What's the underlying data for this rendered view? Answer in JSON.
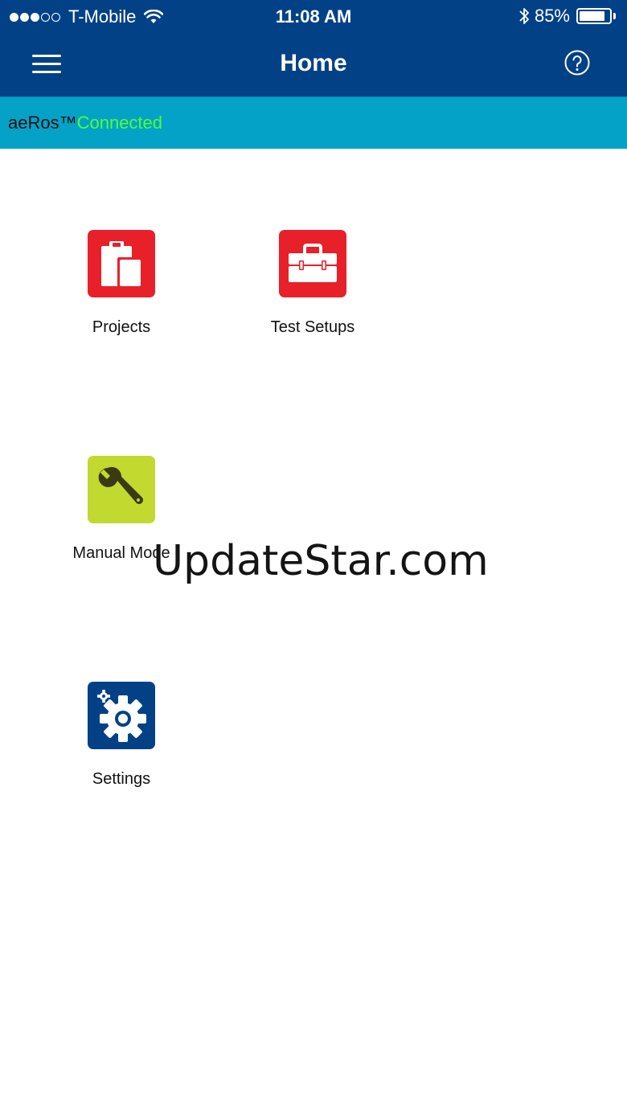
{
  "status_bar": {
    "carrier": "T-Mobile",
    "signal_bars_filled": 3,
    "signal_bars_total": 5,
    "time": "11:08 AM",
    "battery_percent": "85%",
    "battery_level": 0.85,
    "wifi_icon": "wifi-icon",
    "bluetooth_icon": "bluetooth-icon"
  },
  "nav": {
    "title": "Home",
    "menu_icon": "hamburger-menu-icon",
    "help_icon": "help-circle-icon"
  },
  "connection": {
    "device_name": "aeRos™",
    "status": "Connected",
    "status_color": "#4fff35"
  },
  "tiles": [
    {
      "label": "Projects",
      "icon": "clipboard-icon",
      "color": "#e8202a"
    },
    {
      "label": "Test Setups",
      "icon": "toolbox-icon",
      "color": "#e8202a"
    },
    {
      "label": "Manual Mode",
      "icon": "wrench-icon",
      "color": "#c2d92f"
    },
    {
      "label": "Settings",
      "icon": "gear-icon",
      "color": "#034187"
    }
  ],
  "watermark": "UpdateStar.com",
  "colors": {
    "header_blue": "#034187",
    "banner_cyan": "#05a2c7",
    "accent_red": "#e8202a",
    "accent_green": "#c2d92f"
  }
}
